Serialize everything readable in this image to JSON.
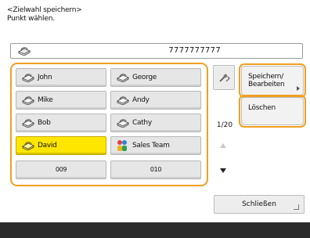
{
  "header": {
    "line1": "<Zielwahl speichern>",
    "line2": "Punkt wählen."
  },
  "destination": {
    "icon": "fax-icon",
    "number": "7777777777"
  },
  "entries": [
    {
      "label": "John",
      "icon": "fax-icon",
      "selected": false
    },
    {
      "label": "George",
      "icon": "fax-icon",
      "selected": false
    },
    {
      "label": "Mike",
      "icon": "fax-icon",
      "selected": false
    },
    {
      "label": "Andy",
      "icon": "fax-icon",
      "selected": false
    },
    {
      "label": "Bob",
      "icon": "fax-icon",
      "selected": false
    },
    {
      "label": "Cathy",
      "icon": "fax-icon",
      "selected": false
    },
    {
      "label": "David",
      "icon": "fax-icon",
      "selected": true
    },
    {
      "label": "Sales Team",
      "icon": "group-icon",
      "selected": false
    },
    {
      "label": "009",
      "icon": "",
      "selected": false
    },
    {
      "label": "010",
      "icon": "",
      "selected": false
    }
  ],
  "pager": {
    "page": "1/20"
  },
  "actions": {
    "save_edit": "Speichern/\nBearbeiten",
    "delete": "Löschen",
    "close": "Schließen"
  },
  "colors": {
    "highlight": "#f0a020",
    "selected": "#ffe600",
    "bottom_bar": "#2a2a2a"
  }
}
